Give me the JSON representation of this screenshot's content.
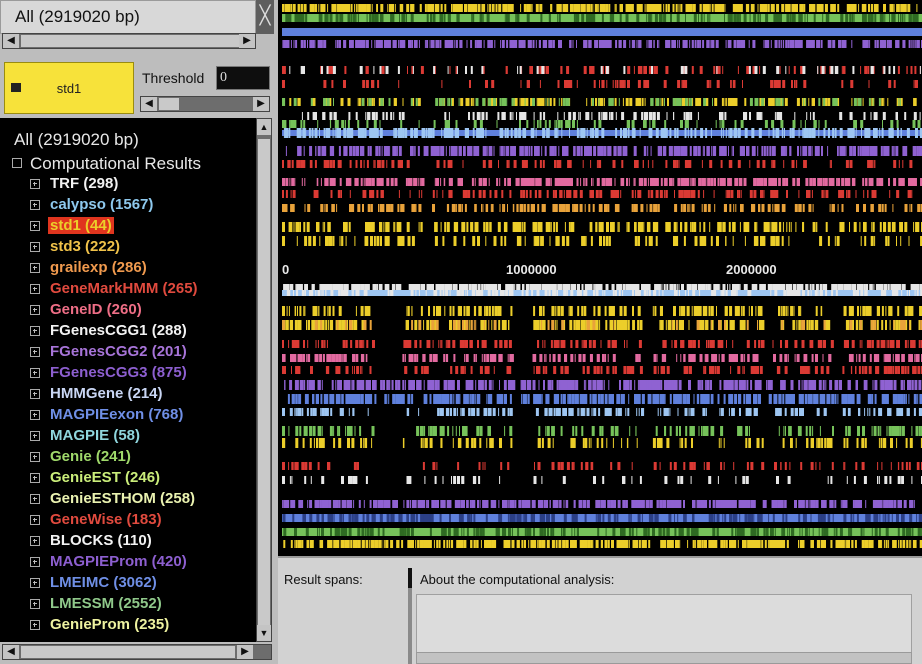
{
  "window": {
    "title": "All (2919020 bp)",
    "close_glyph": "╳"
  },
  "track_button": {
    "label": "std1"
  },
  "threshold": {
    "label": "Threshold",
    "value": "0"
  },
  "tree": {
    "root": "All (2919020 bp)",
    "group": "Computational Results",
    "items": [
      {
        "label": "TRF (298)",
        "color": "#f2f2f2"
      },
      {
        "label": "calypso (1567)",
        "color": "#8ec9ee"
      },
      {
        "label": "std1 (44)",
        "color": "#f7d83a",
        "selected": true
      },
      {
        "label": "std3 (222)",
        "color": "#f0c24a"
      },
      {
        "label": "grailexp (286)",
        "color": "#f09a4e"
      },
      {
        "label": "GeneMarkHMM (265)",
        "color": "#e04a3e"
      },
      {
        "label": "GeneID (260)",
        "color": "#ee6e86"
      },
      {
        "label": "FGenesCGG1 (288)",
        "color": "#f2f2f2"
      },
      {
        "label": "FGenesCGG2 (201)",
        "color": "#a774d8"
      },
      {
        "label": "FGenesCGG3 (875)",
        "color": "#8d5fd0"
      },
      {
        "label": "HMMGene (214)",
        "color": "#c9d6f4"
      },
      {
        "label": "MAGPIEexon (768)",
        "color": "#6f8fe6"
      },
      {
        "label": "MAGPIE (58)",
        "color": "#8fd6dd"
      },
      {
        "label": "Genie (241)",
        "color": "#9fd86a"
      },
      {
        "label": "GenieEST (246)",
        "color": "#caed7a"
      },
      {
        "label": "GenieESTHOM (258)",
        "color": "#eaf2b0"
      },
      {
        "label": "GeneWise (183)",
        "color": "#e04a3e"
      },
      {
        "label": "BLOCKS (110)",
        "color": "#f2f2f2"
      },
      {
        "label": "MAGPIEProm (420)",
        "color": "#8d5fd0"
      },
      {
        "label": "LMEIMC (3062)",
        "color": "#6f8fe6"
      },
      {
        "label": "LMESSM (2552)",
        "color": "#8fc88a"
      },
      {
        "label": "GenieProm (235)",
        "color": "#eef2a0"
      }
    ]
  },
  "ruler": {
    "ticks": [
      {
        "label": "0",
        "pos": 0
      },
      {
        "label": "1000000",
        "pos": 1000000
      },
      {
        "label": "2000000",
        "pos": 2000000
      }
    ]
  },
  "track_colors": {
    "yellow": "#ecce2a",
    "green": "#76c25a",
    "blue": "#5f80dc",
    "purple": "#8f62d2",
    "pink": "#e26aa0",
    "red": "#db3a34",
    "white": "#e6e6e6",
    "lightblue": "#9ec6f2",
    "orange": "#e8a23a"
  },
  "bottom": {
    "spans_label": "Result spans:",
    "about_label": "About the computational analysis:"
  }
}
